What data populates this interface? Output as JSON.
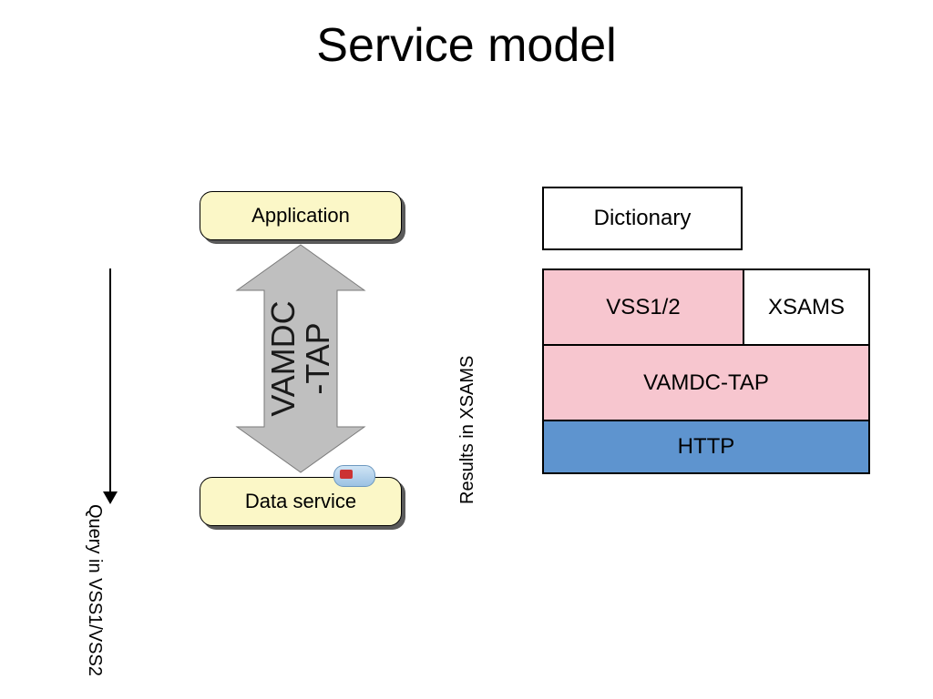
{
  "title": "Service model",
  "left_diagram": {
    "top_box": "Application",
    "center_label_line1": "VAMDC",
    "center_label_line2": "-TAP",
    "left_side_label": "Query in VSS1/VSS2",
    "right_side_label": "Results in XSAMS",
    "bottom_box": "Data service"
  },
  "right_stack": {
    "dictionary": "Dictionary",
    "vss": "VSS1/2",
    "xsams": "XSAMS",
    "vamdc_tap": "VAMDC-TAP",
    "http": "HTTP"
  },
  "colors": {
    "yellow_box": "#fbf7c7",
    "pink_cell": "#f7c6cf",
    "blue_cell": "#5e94cf",
    "arrow_fill": "#bfbfbf"
  }
}
